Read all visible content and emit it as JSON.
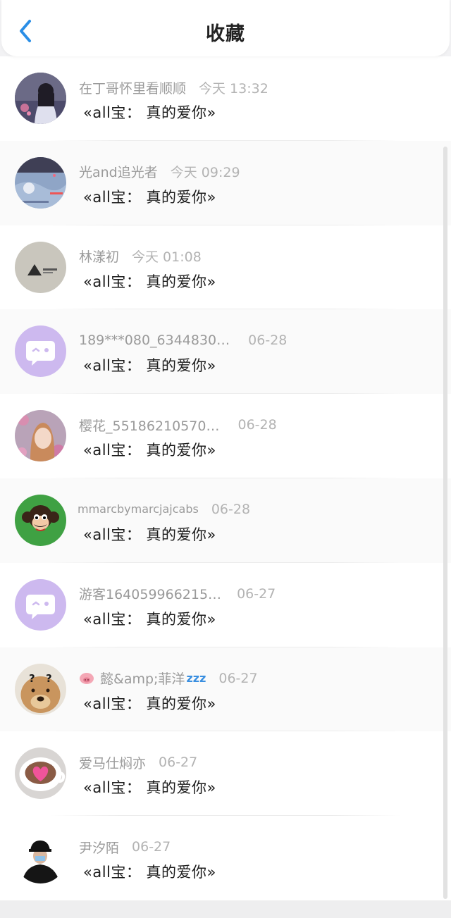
{
  "header": {
    "back_icon": "chevron-left-icon",
    "back_color": "#2a8ee6",
    "title": "收藏"
  },
  "favorites": [
    {
      "name": "在丁哥怀里看顺顺",
      "time": "今天 13:32",
      "message": "«all宝：  真的爱你»"
    },
    {
      "name": "光and追光者",
      "time": "今天 09:29",
      "message": "«all宝：  真的爱你»"
    },
    {
      "name": "林漾初",
      "time": "今天 01:08",
      "message": "«all宝：  真的爱你»"
    },
    {
      "name": "189***080_6344830…",
      "time": "06-28",
      "message": "«all宝：  真的爱你»"
    },
    {
      "name": "樱花_55186210570…",
      "time": "06-28",
      "message": "«all宝：  真的爱你»"
    },
    {
      "name": "mmarcbymarcjajcabs",
      "time": "06-28",
      "message": "«all宝：  真的爱你»"
    },
    {
      "name": "游客164059966215…",
      "time": "06-27",
      "message": "«all宝：  真的爱你»"
    },
    {
      "name": "懿&amp;菲洋",
      "time": "06-27",
      "message": "«all宝：  真的爱你»"
    },
    {
      "name": "爱马仕焖亦",
      "time": "06-27",
      "message": "«all宝：  真的爱你»"
    },
    {
      "name": "尹汐陌",
      "time": "06-27",
      "message": "«all宝：  真的爱你»"
    }
  ],
  "emoji": {
    "pig": "pig-face-icon",
    "sleep": "zzz"
  },
  "colors": {
    "accent": "#2a8ee6",
    "default_avatar_bg": "#cdb9ef",
    "monkey_avatar_bg": "#3fa143"
  }
}
